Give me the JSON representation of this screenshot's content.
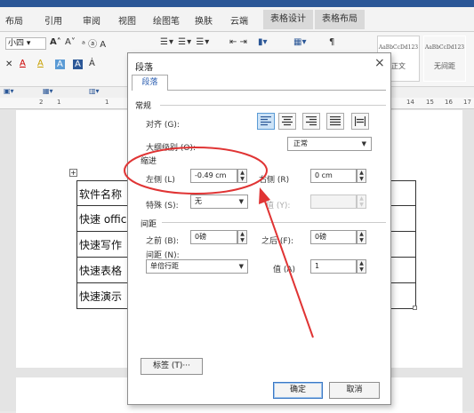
{
  "ribbon_tabs": [
    "布局",
    "引用",
    "审阅",
    "视图",
    "绘图笔",
    "换肤",
    "云端",
    "表格设计",
    "表格布局"
  ],
  "ribbon": {
    "font_size": "小四",
    "font_grow": "A˄",
    "font_shrink": "A˅",
    "style_samples": [
      {
        "sample": "AaBbCcDd123",
        "name": "正文"
      },
      {
        "sample": "AaBbCcDd123",
        "name": "无间距"
      }
    ]
  },
  "ruler_numbers": [
    "2",
    "1",
    "1",
    "14",
    "15",
    "16",
    "17"
  ],
  "document": {
    "rows": [
      "软件名称",
      "快速 office",
      "快速写作",
      "快速表格",
      "快速演示"
    ]
  },
  "dialog": {
    "title": "段落",
    "close_glyph": "×",
    "tab": "段落",
    "general": {
      "section": "常规",
      "alignment_label": "对齐 (G):",
      "outline_label": "大纲级别 (O):",
      "outline_value": "正常"
    },
    "indent": {
      "section": "缩进",
      "left_label": "左侧 (L)",
      "left_value": "-0.49 cm",
      "right_label": "右侧 (R)",
      "right_value": "0 cm",
      "special_label": "特殊 (S):",
      "special_value": "无",
      "by_label": "值 (Y):",
      "by_value": ""
    },
    "spacing": {
      "section": "间距",
      "before_label": "之前 (B):",
      "before_value": "0磅",
      "after_label": "之后 (F):",
      "after_value": "0磅",
      "line_label": "间距 (N):",
      "line_value": "单倍行距",
      "at_label": "值 (A)",
      "at_value": "1"
    },
    "tabs_button": "标签 (T)···",
    "ok_button": "确定",
    "cancel_button": "取消"
  },
  "colors": {
    "accent": "#2b5797",
    "annotation_red": "#e03434",
    "selected_blue": "#cde3f7"
  }
}
